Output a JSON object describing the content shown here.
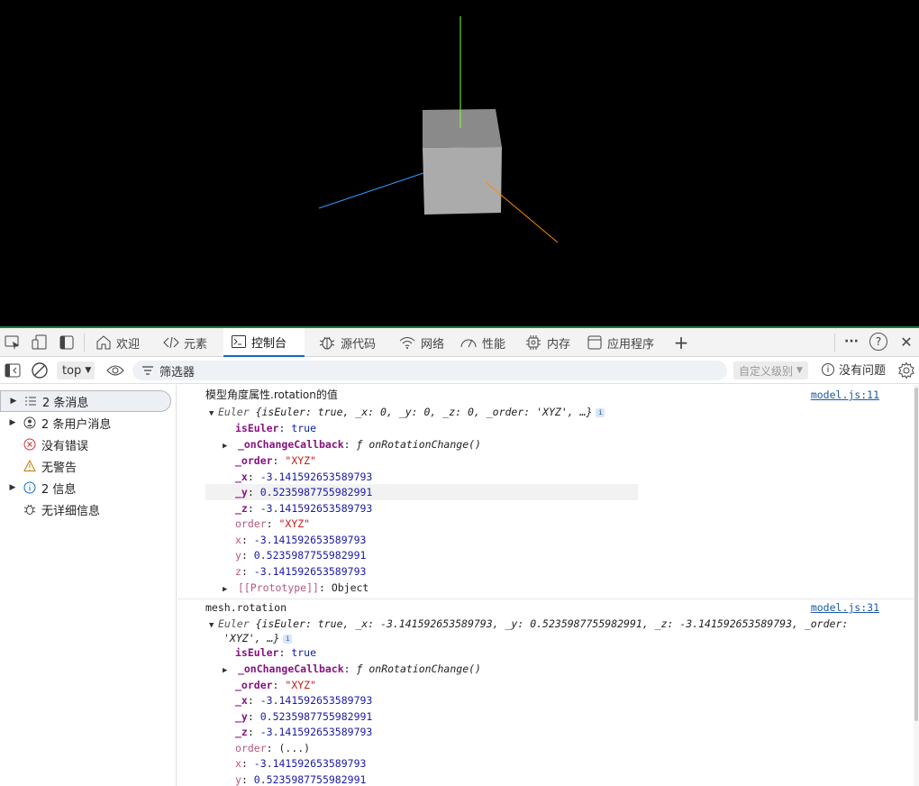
{
  "scene": {
    "background": "#000000",
    "axis_colors": {
      "x": "#ff8800",
      "y": "#88ff33",
      "z": "#3399ff"
    },
    "cube_colors": {
      "top": "#8a8a8a",
      "front": "#ababab",
      "side": "#7a7a7a"
    }
  },
  "devtools": {
    "tabs": [
      {
        "label": "欢迎",
        "icon": "home-icon"
      },
      {
        "label": "元素",
        "icon": "code-icon"
      },
      {
        "label": "控制台",
        "icon": "console-icon",
        "active": true
      },
      {
        "label": "源代码",
        "icon": "bug-icon"
      },
      {
        "label": "网络",
        "icon": "wifi-icon"
      },
      {
        "label": "性能",
        "icon": "gauge-icon"
      },
      {
        "label": "内存",
        "icon": "chip-icon"
      },
      {
        "label": "应用程序",
        "icon": "app-icon"
      }
    ],
    "add_tab": "+",
    "more": "···",
    "help": "?",
    "close": "✕",
    "accent": "#0f6cbd"
  },
  "toolbar": {
    "context": "top",
    "filter_placeholder": "筛选器",
    "level": "自定义级别",
    "issues": "没有问题"
  },
  "sidebar": {
    "items": [
      {
        "label": "2 条消息",
        "icon": "list-icon",
        "expandable": true,
        "selected": true
      },
      {
        "label": "2 条用户消息",
        "icon": "user-icon",
        "expandable": true
      },
      {
        "label": "没有错误",
        "icon": "error-icon",
        "expandable": false
      },
      {
        "label": "无警告",
        "icon": "warning-icon",
        "expandable": false
      },
      {
        "label": "2 信息",
        "icon": "info-icon",
        "expandable": true
      },
      {
        "label": "无详细信息",
        "icon": "bug-icon",
        "expandable": false
      }
    ]
  },
  "console": {
    "msg1": {
      "text": "模型角度属性.rotation的值",
      "source": "model.js:11",
      "summary_name": "Euler",
      "summary": "{isEuler: true, _x: 0, _y: 0, _z: 0, _order: 'XYZ', …}",
      "props": {
        "isEuler_k": "isEuler",
        "isEuler_v": "true",
        "cb_k": "_onChangeCallback",
        "cb_v": "ƒ onRotationChange()",
        "order_k": "_order",
        "order_v": "\"XYZ\"",
        "x_k": "_x",
        "x_v": "-3.141592653589793",
        "y_k": "_y",
        "y_v": "0.5235987755982991",
        "z_k": "_z",
        "z_v": "-3.141592653589793",
        "gorder_k": "order",
        "gorder_v": "\"XYZ\"",
        "gx_k": "x",
        "gx_v": "-3.141592653589793",
        "gy_k": "y",
        "gy_v": "0.5235987755982991",
        "gz_k": "z",
        "gz_v": "-3.141592653589793",
        "proto_k": "[[Prototype]]",
        "proto_v": "Object"
      }
    },
    "msg2": {
      "text": "mesh.rotation",
      "source": "model.js:31",
      "summary_name": "Euler",
      "summary1": "{isEuler: true, _x: -3.141592653589793, _y: 0.5235987755982991, _z: -3.141592653589793, _order:",
      "summary2": "'XYZ', …}",
      "props": {
        "isEuler_k": "isEuler",
        "isEuler_v": "true",
        "cb_k": "_onChangeCallback",
        "cb_v": "ƒ onRotationChange()",
        "order_k": "_order",
        "order_v": "\"XYZ\"",
        "x_k": "_x",
        "x_v": "-3.141592653589793",
        "y_k": "_y",
        "y_v": "0.5235987755982991",
        "z_k": "_z",
        "z_v": "-3.141592653589793",
        "gorder_k": "order",
        "gorder_v": "(...)",
        "gx_k": "x",
        "gx_v": "-3.141592653589793",
        "gy_k": "y",
        "gy_v": "0.5235987755982991"
      }
    }
  }
}
